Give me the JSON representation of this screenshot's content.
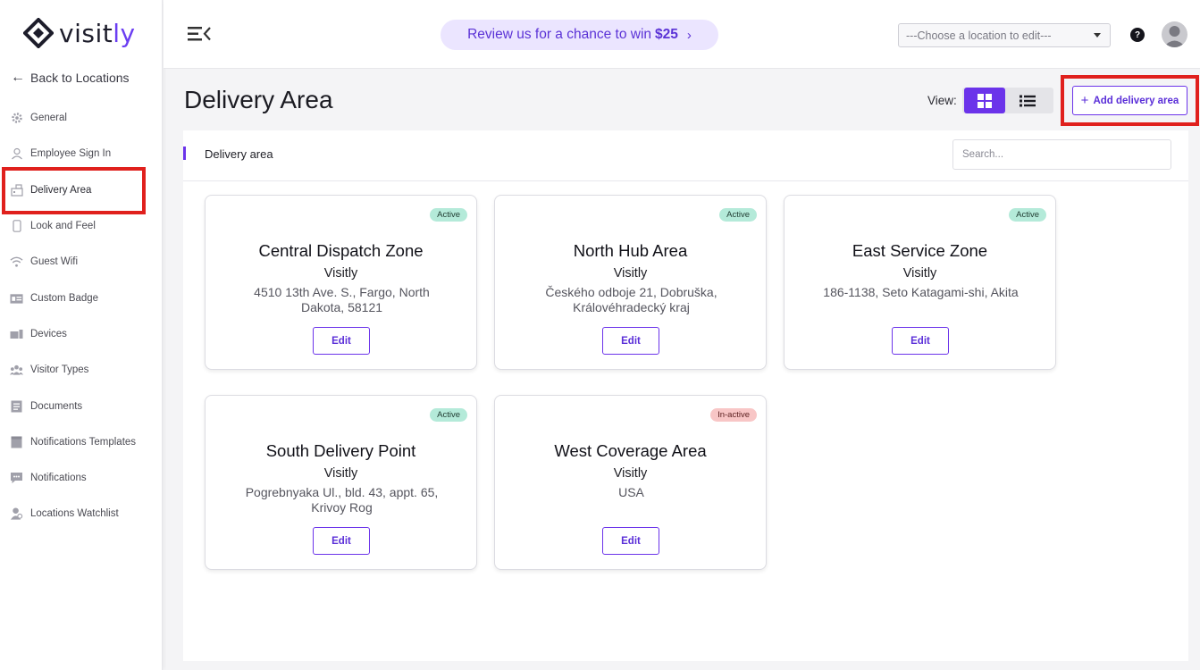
{
  "brand": {
    "name_prefix": "visit",
    "name_suffix": "ly",
    "accent": "#6b33ea"
  },
  "sidebar": {
    "back_label": "Back to Locations",
    "items": [
      {
        "label": "General",
        "icon": "gear-icon"
      },
      {
        "label": "Employee Sign In",
        "icon": "user-icon"
      },
      {
        "label": "Delivery Area",
        "icon": "building-icon",
        "active": true
      },
      {
        "label": "Look and Feel",
        "icon": "phone-icon"
      },
      {
        "label": "Guest Wifi",
        "icon": "wifi-icon"
      },
      {
        "label": "Custom Badge",
        "icon": "badge-icon"
      },
      {
        "label": "Devices",
        "icon": "devices-icon"
      },
      {
        "label": "Visitor Types",
        "icon": "visitors-icon"
      },
      {
        "label": "Documents",
        "icon": "document-icon"
      },
      {
        "label": "Notifications Templates",
        "icon": "template-icon"
      },
      {
        "label": "Notifications",
        "icon": "chat-icon"
      },
      {
        "label": "Locations Watchlist",
        "icon": "watchlist-icon"
      }
    ]
  },
  "header": {
    "promo_text": "Review us for a chance to win",
    "promo_amount": "$25",
    "location_placeholder": "---Choose a location to edit---",
    "help_label": "?"
  },
  "page": {
    "title": "Delivery Area",
    "view_label": "View:",
    "add_button": "Add delivery area"
  },
  "panel": {
    "title": "Delivery area",
    "search_placeholder": "Search..."
  },
  "cards": [
    {
      "status": "Active",
      "title": "Central Dispatch Zone",
      "org": "Visitly",
      "address": "4510 13th Ave. S., Fargo, North Dakota, 58121",
      "edit": "Edit"
    },
    {
      "status": "Active",
      "title": "North Hub Area",
      "org": "Visitly",
      "address": "Českého odboje 21, Dobruška, Královéhradecký kraj",
      "edit": "Edit"
    },
    {
      "status": "Active",
      "title": "East Service Zone",
      "org": "Visitly",
      "address": "186-1138, Seto Katagami-shi, Akita",
      "edit": "Edit"
    },
    {
      "status": "Active",
      "title": "South Delivery Point",
      "org": "Visitly",
      "address": "Pogrebnyaka Ul., bld. 43, appt. 65, Krivoy Rog",
      "edit": "Edit"
    },
    {
      "status": "In-active",
      "title": "West Coverage Area",
      "org": "Visitly",
      "address": "USA",
      "edit": "Edit"
    }
  ]
}
